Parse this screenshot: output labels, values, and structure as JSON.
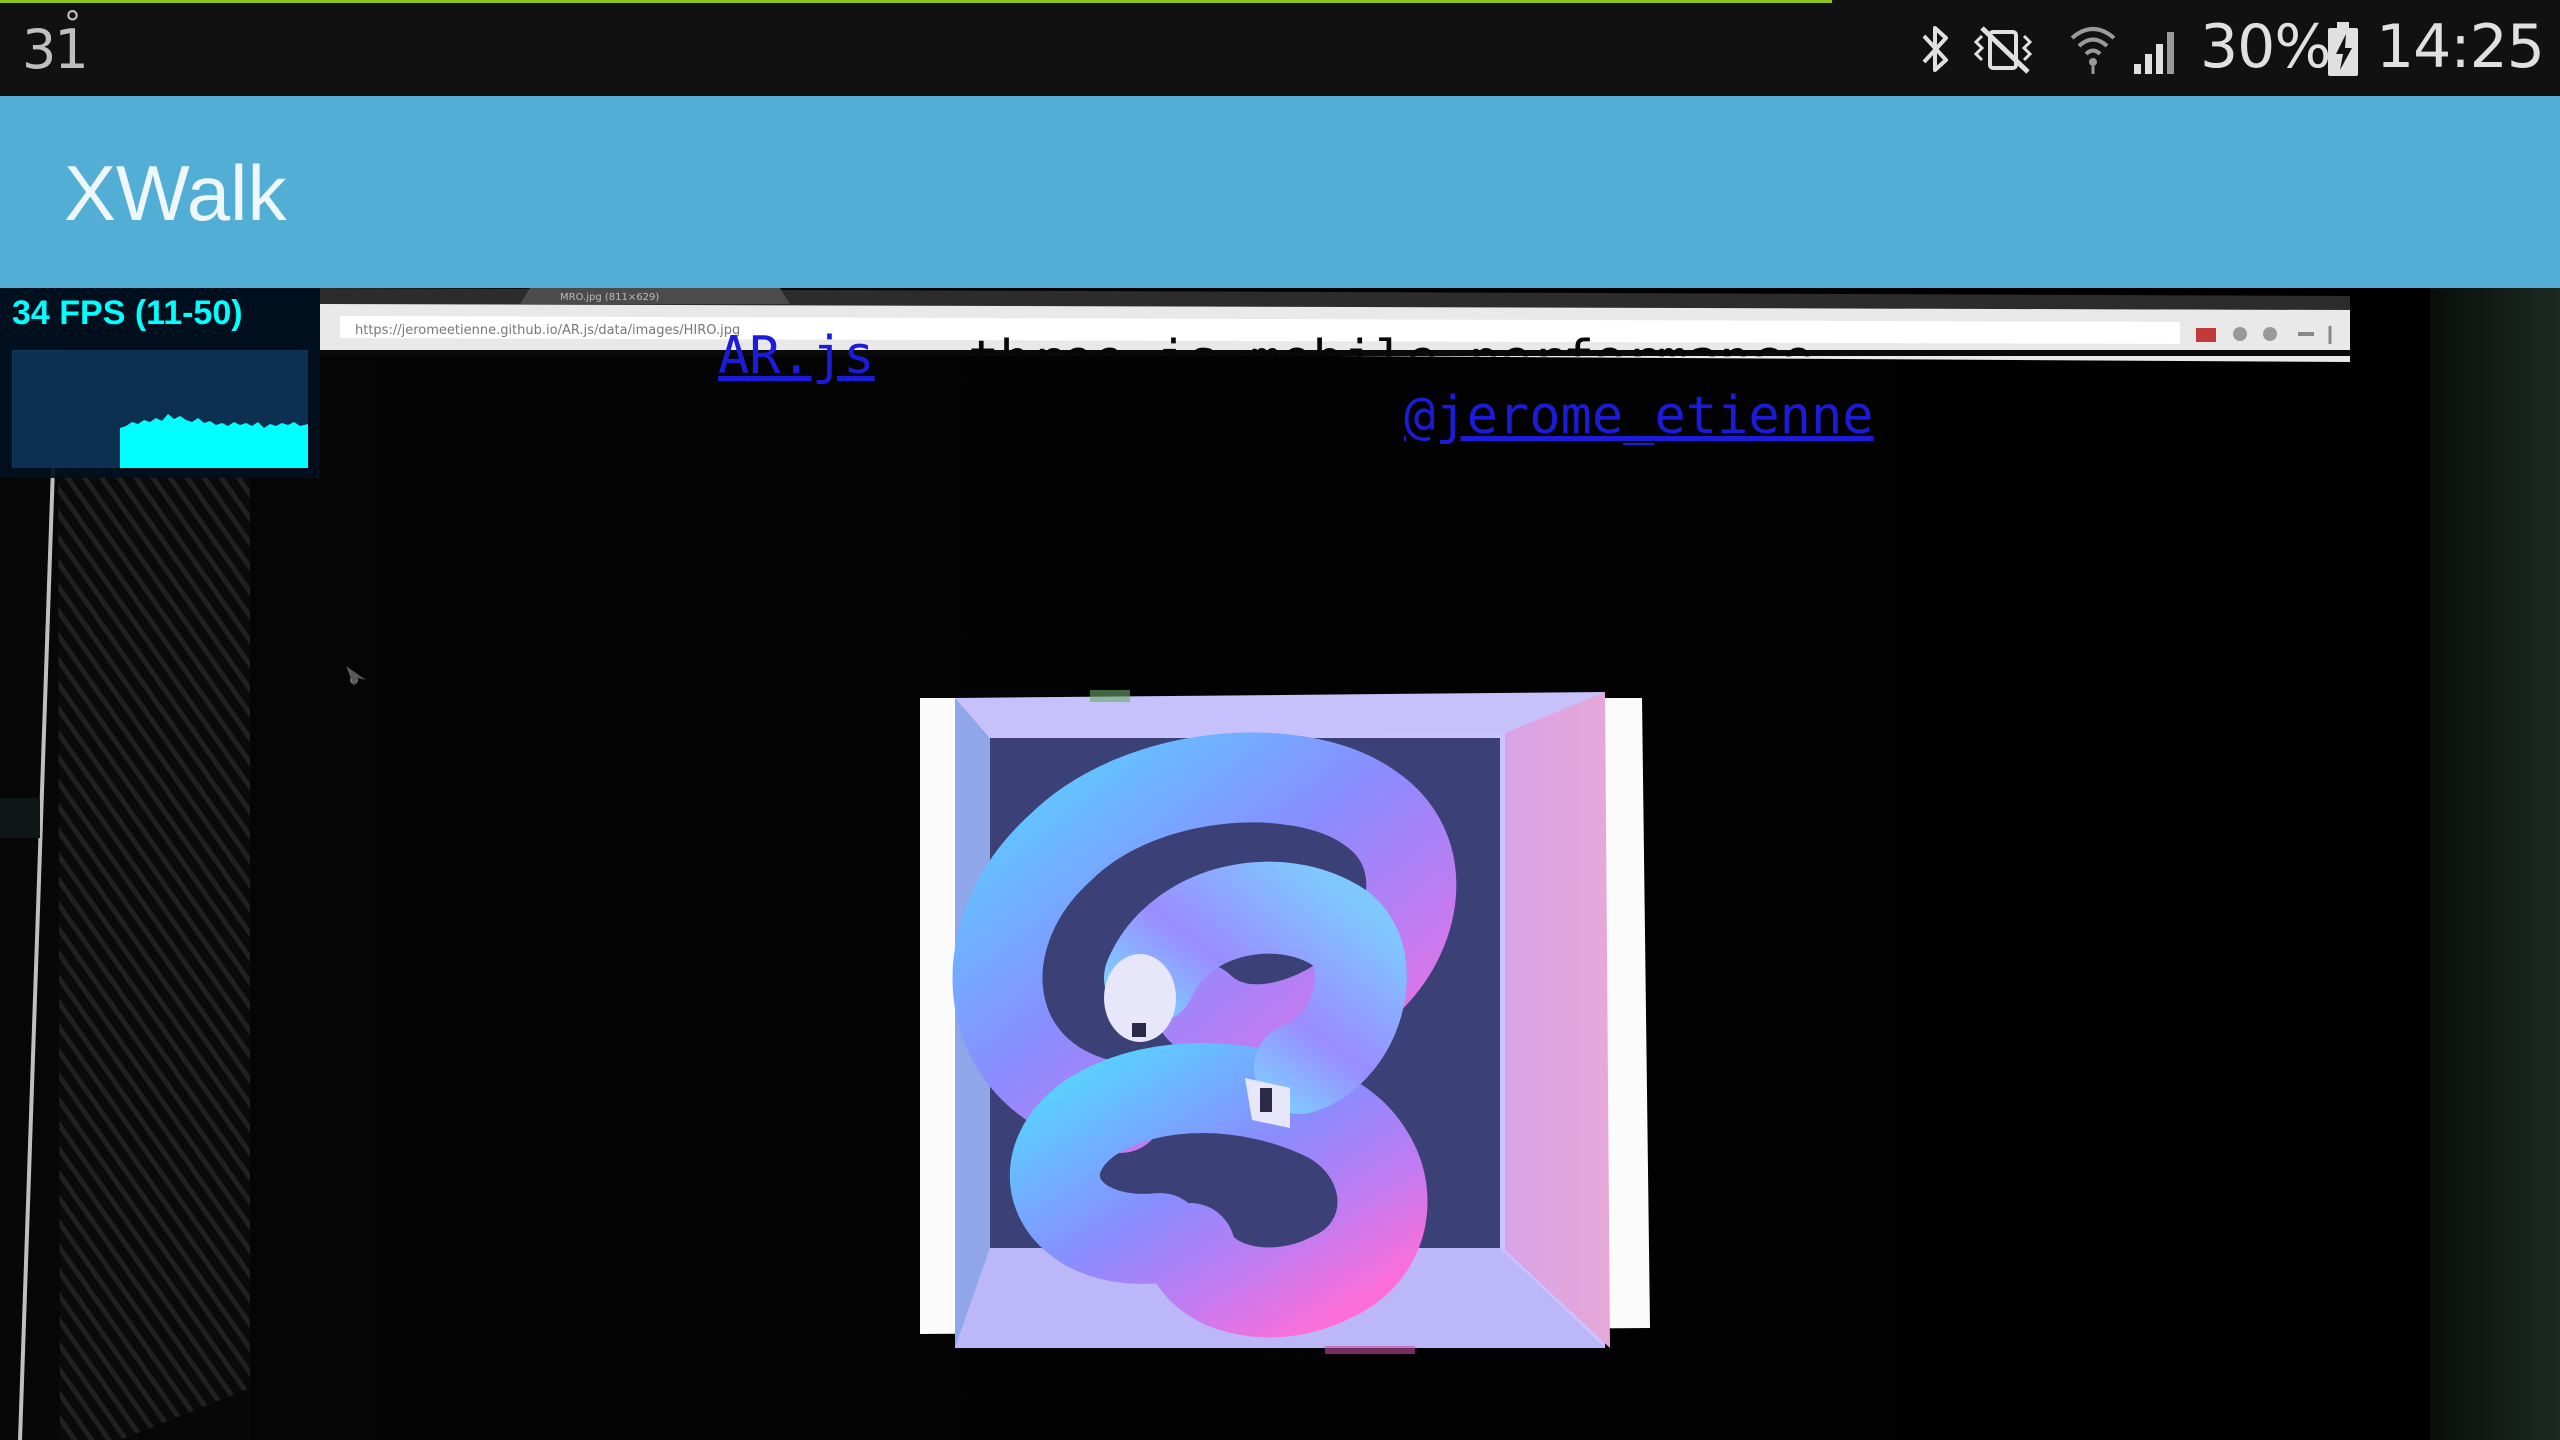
{
  "status_bar": {
    "temperature": "31",
    "temperature_degree": "°",
    "battery_percent": "30%",
    "clock": "14:25",
    "icons": [
      "bluetooth-icon",
      "vibrate-mute-icon",
      "wifi-icon",
      "cellular-signal-icon",
      "battery-charging-icon"
    ]
  },
  "app_bar": {
    "title": "XWalk",
    "color": "#52aed5"
  },
  "page": {
    "link_arjs": "AR.js",
    "title_text": "three.js mobile performance",
    "link_author": "@jerome_etienne"
  },
  "stats": {
    "fps_text": "34 FPS (11-50)",
    "current_fps": 34,
    "min_fps": 11,
    "max_fps": 50,
    "color": "#00ffff"
  },
  "colors": {
    "load_progress": "#8fc31f",
    "link": "#1b1bd8"
  }
}
